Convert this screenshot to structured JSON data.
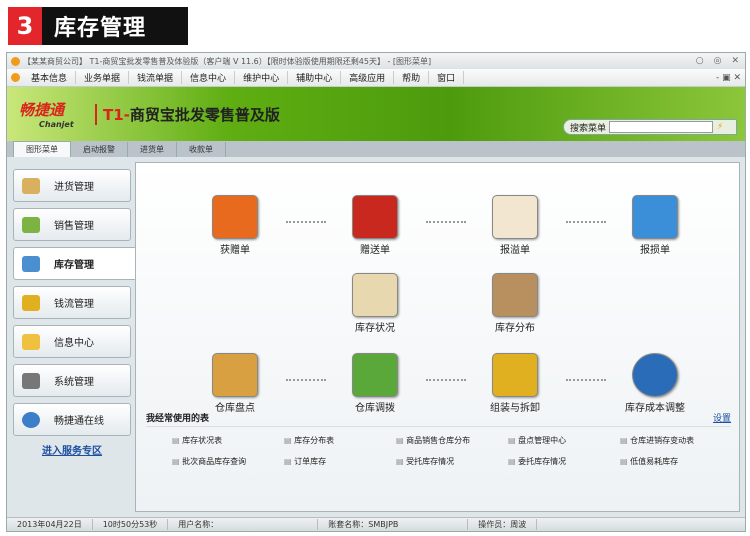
{
  "header": {
    "number": "3",
    "title": "库存管理"
  },
  "window": {
    "title": "【某某商贸公司】 T1-商贸宝批发零售普及体验版（客户端 V 11.6）【限时体验版使用期限还剩45天】 - [图形菜单]"
  },
  "menu": [
    "基本信息",
    "业务单据",
    "钱流单据",
    "信息中心",
    "维护中心",
    "辅助中心",
    "高级应用",
    "帮助",
    "窗口"
  ],
  "banner": {
    "logo": "畅捷通",
    "logo_en": "Chanjet",
    "product_prefix": "T1-",
    "product": "商贸宝批发零售普及版",
    "search_label": "搜索菜单",
    "search_value": ""
  },
  "tabs": [
    "图形菜单",
    "启动报警",
    "进货单",
    "收款单"
  ],
  "sidebar": {
    "items": [
      "进货管理",
      "销售管理",
      "库存管理",
      "钱流管理",
      "信息中心",
      "系统管理",
      "畅捷通在线"
    ],
    "service_link": "进入服务专区"
  },
  "flow": {
    "nodes": [
      "获赠单",
      "赠送单",
      "报溢单",
      "报损单",
      "库存状况",
      "库存分布",
      "仓库盘点",
      "仓库调拨",
      "组装与拆卸",
      "库存成本调整"
    ]
  },
  "favorites": {
    "title": "我经常使用的表",
    "settings": "设置",
    "items": [
      "库存状况表",
      "库存分布表",
      "商品销售仓库分布",
      "盘点管理中心",
      "仓库进销存变动表",
      "批次商品库存查询",
      "订单库存",
      "受托库存情况",
      "委托库存情况",
      "低值易耗库存"
    ]
  },
  "status": {
    "date": "2013年04月22日",
    "time": "10时50分53秒",
    "user": "用户名称：",
    "account": "账套名称：SMBJPB",
    "operator": "操作员：周波"
  }
}
